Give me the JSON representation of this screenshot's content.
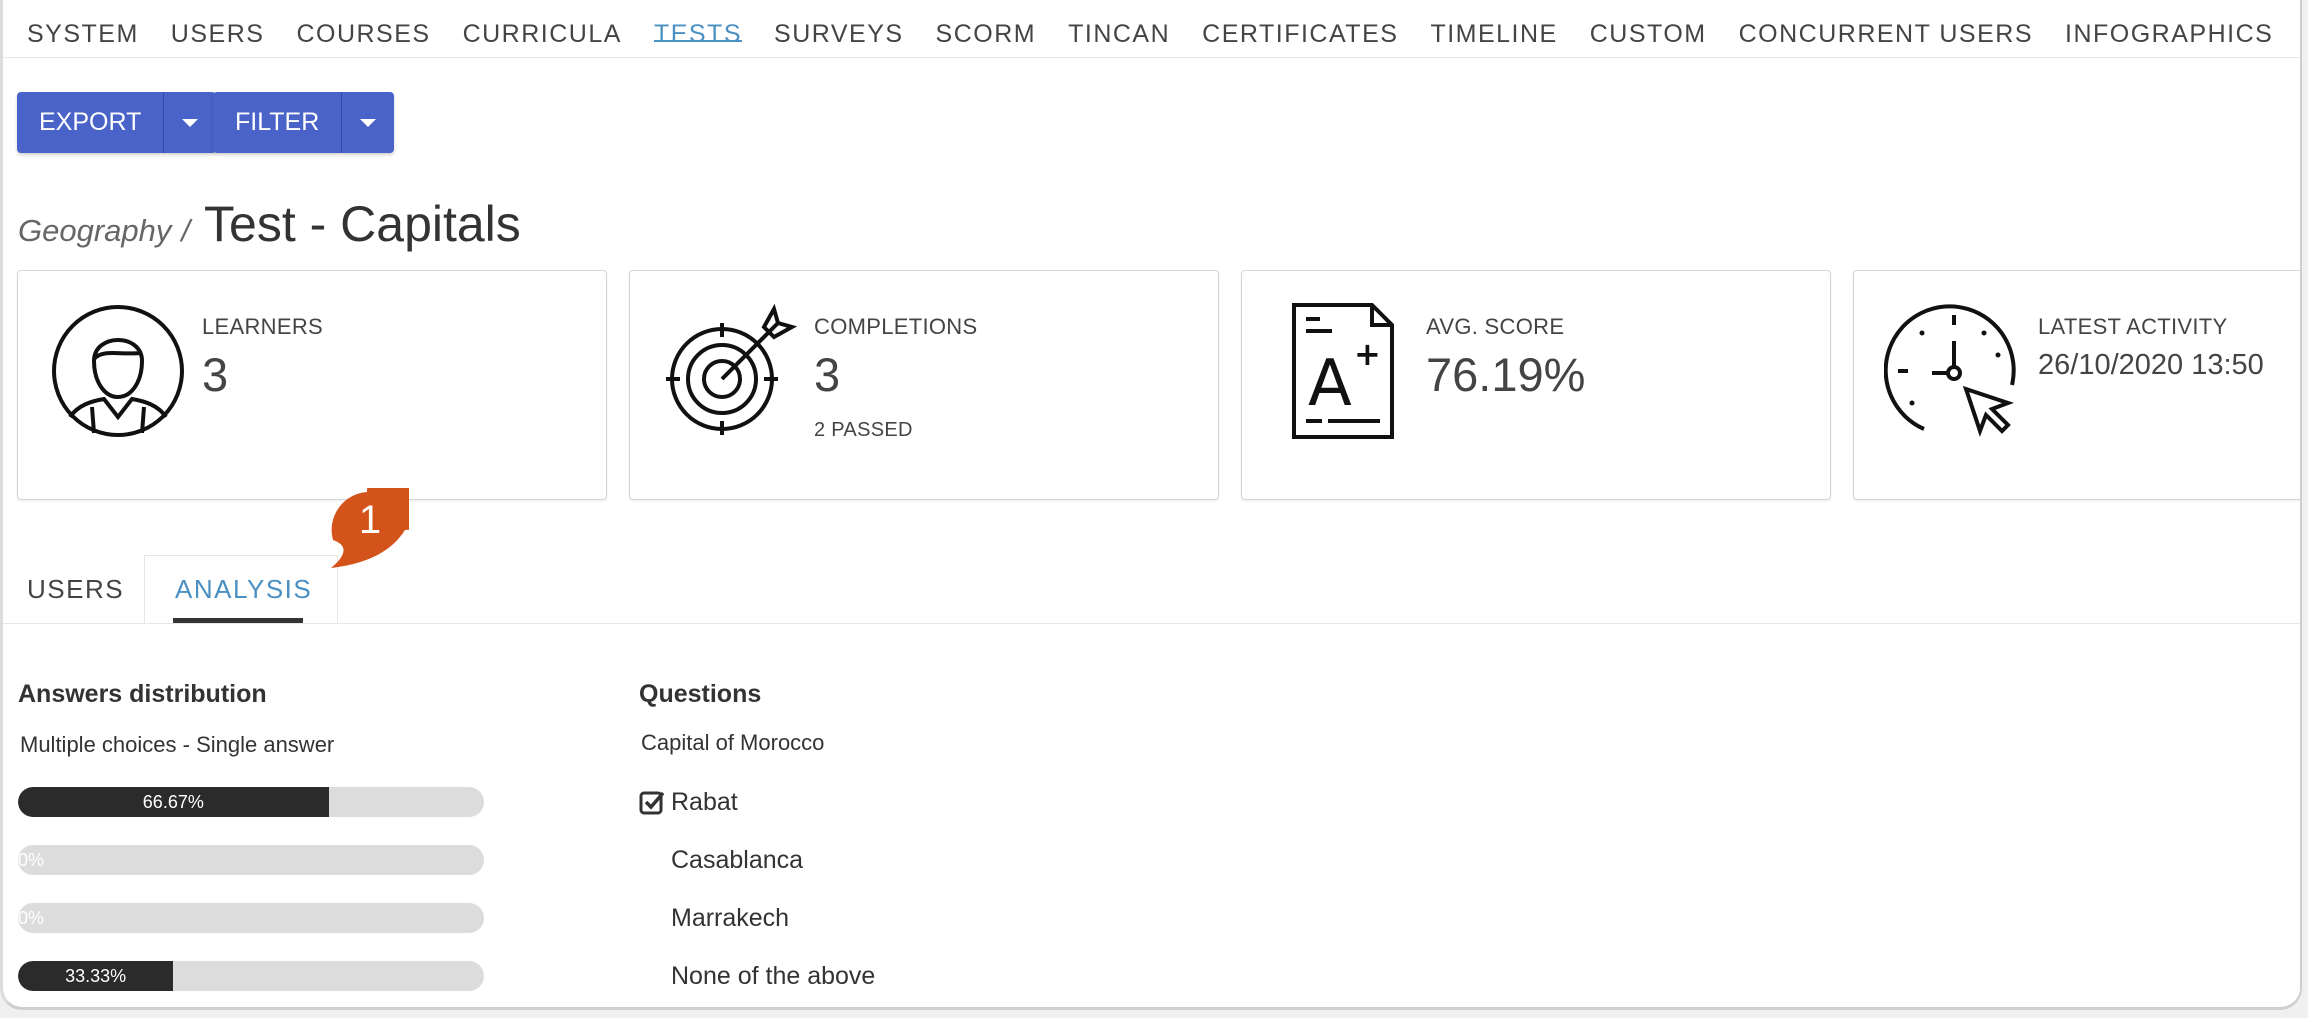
{
  "nav": {
    "items": [
      "SYSTEM",
      "USERS",
      "COURSES",
      "CURRICULA",
      "TESTS",
      "SURVEYS",
      "SCORM",
      "TINCAN",
      "CERTIFICATES",
      "TIMELINE",
      "CUSTOM",
      "CONCURRENT USERS",
      "INFOGRAPHICS"
    ],
    "active": "TESTS"
  },
  "toolbar": {
    "export_label": "EXPORT",
    "filter_label": "FILTER"
  },
  "breadcrumb": {
    "parent": "Geography",
    "separator": "/",
    "title": "Test - Capitals"
  },
  "stats": {
    "learners": {
      "label": "LEARNERS",
      "value": "3"
    },
    "completions": {
      "label": "COMPLETIONS",
      "value": "3",
      "sub": "2 PASSED"
    },
    "avg_score": {
      "label": "AVG. SCORE",
      "value": "76.19%"
    },
    "latest_activity": {
      "label": "LATEST ACTIVITY",
      "value": "26/10/2020 13:50"
    }
  },
  "tabs": {
    "users": "USERS",
    "analysis": "ANALYSIS",
    "active": "ANALYSIS"
  },
  "callout": {
    "number": "1"
  },
  "analysis": {
    "distribution_title": "Answers distribution",
    "question_type": "Multiple choices - Single answer",
    "questions_title": "Questions",
    "question": "Capital of Morocco",
    "answers": [
      {
        "text": "Rabat",
        "correct": true,
        "percent": 66.67,
        "label": "66.67%"
      },
      {
        "text": "Casablanca",
        "correct": false,
        "percent": 0,
        "label": "0%"
      },
      {
        "text": "Marrakech",
        "correct": false,
        "percent": 0,
        "label": "0%"
      },
      {
        "text": "None of the above",
        "correct": false,
        "percent": 33.33,
        "label": "33.33%"
      }
    ]
  },
  "colors": {
    "primary_button": "#4a63c9",
    "active_tab": "#4a90c2",
    "callout": "#d4531a",
    "bar_fill": "#2b2b2b",
    "bar_track": "#dcdcdc"
  }
}
